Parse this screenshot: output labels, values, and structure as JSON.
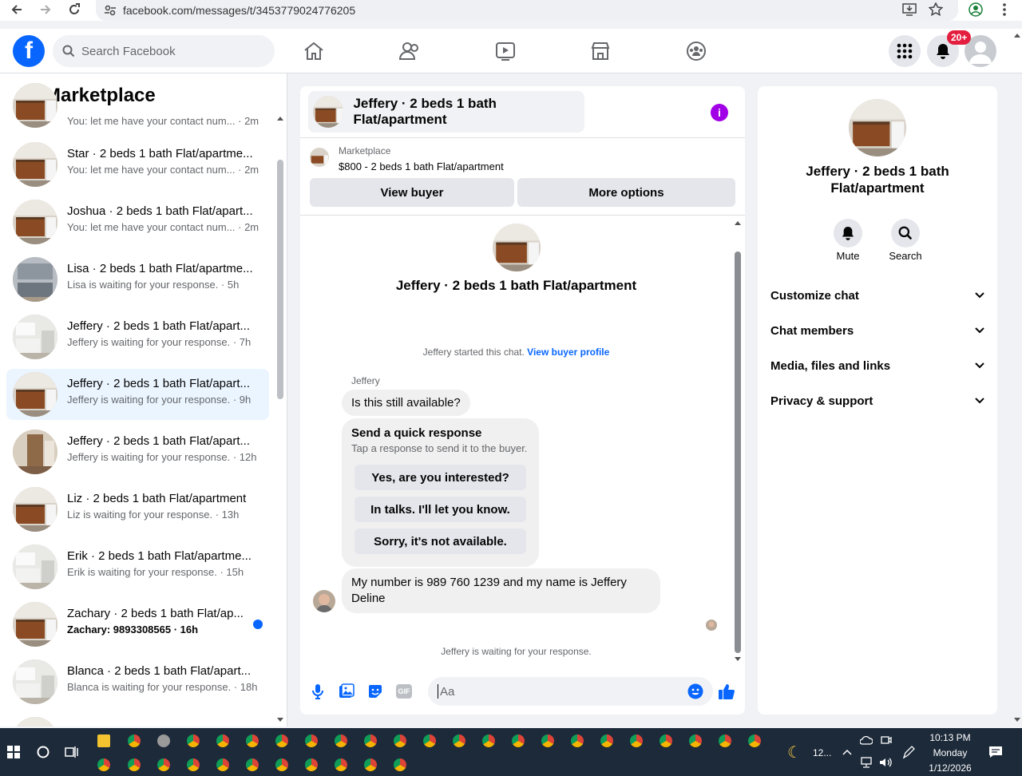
{
  "browser": {
    "url": "facebook.com/messages/t/3453779024776205"
  },
  "header": {
    "search_placeholder": "Search Facebook",
    "notif_badge": "20+",
    "logo_letter": "f"
  },
  "left": {
    "title": "Marketplace",
    "top_partial_sub": "You: let me have your contact num... · 2m",
    "conversations": [
      {
        "title": "Star · 2 beds 1 bath Flat/apartme...",
        "sub": "You: let me have your contact num... · 2m",
        "bold": false,
        "unread": false,
        "photo": "kitchen"
      },
      {
        "title": "Joshua · 2 beds 1 bath Flat/apart...",
        "sub": "You: let me have your contact num... · 2m",
        "bold": false,
        "unread": false,
        "photo": "kitchen"
      },
      {
        "title": "Lisa · 2 beds 1 bath Flat/apartme...",
        "sub": "Lisa is waiting for your response. · 5h",
        "bold": false,
        "unread": false,
        "photo": "grey"
      },
      {
        "title": "Jeffery · 2 beds 1 bath Flat/apart...",
        "sub": "Jeffery is waiting for your response. · 7h",
        "bold": false,
        "unread": false,
        "photo": "white"
      },
      {
        "title": "Jeffery · 2 beds 1 bath Flat/apart...",
        "sub": "Jeffery is waiting for your response. · 9h",
        "bold": false,
        "unread": false,
        "photo": "kitchen",
        "selected": true
      },
      {
        "title": "Jeffery · 2 beds 1 bath Flat/apart...",
        "sub": "Jeffery is waiting for your response. · 12h",
        "bold": false,
        "unread": false,
        "photo": "hall"
      },
      {
        "title": "Liz · 2 beds 1 bath Flat/apartment",
        "sub": "Liz is waiting for your response. · 13h",
        "bold": false,
        "unread": false,
        "photo": "kitchen"
      },
      {
        "title": "Erik · 2 beds 1 bath Flat/apartme...",
        "sub": "Erik is waiting for your response. · 15h",
        "bold": false,
        "unread": false,
        "photo": "white"
      },
      {
        "title": "Zachary · 2 beds 1 bath Flat/ap...",
        "sub": "Zachary: 9893308565 · 16h",
        "bold": true,
        "unread": true,
        "photo": "kitchen"
      },
      {
        "title": "Blanca · 2 beds 1 bath Flat/apart...",
        "sub": "Blanca is waiting for your response. · 18h",
        "bold": false,
        "unread": false,
        "photo": "white"
      }
    ]
  },
  "chat": {
    "header_title": "Jeffery · 2 beds 1 bath Flat/apartment",
    "info_icon": "i",
    "marketplace_label": "Marketplace",
    "listing": "$800 - 2 beds 1 bath Flat/apartment",
    "view_buyer": "View buyer",
    "more_options": "More options",
    "big_name": "Jeffery · 2 beds 1 bath Flat/apartment",
    "started_text": "Jeffery started this chat.",
    "view_profile": "View buyer profile",
    "sender": "Jeffery",
    "msg1": "Is this still available?",
    "quick_title": "Send a quick response",
    "quick_sub": "Tap a response to send it to the buyer.",
    "quick_options": [
      "Yes, are you interested?",
      "In talks. I'll let you know.",
      "Sorry, it's not available."
    ],
    "msg2": "My number is 989 760 1239 and my name is Jeffery Deline",
    "waiting": "Jeffery is waiting for your response.",
    "composer_placeholder": "Aa",
    "gif_label": "GIF"
  },
  "details": {
    "name": "Jeffery · 2 beds 1 bath Flat/apartment",
    "mute": "Mute",
    "search": "Search",
    "sections": [
      "Customize chat",
      "Chat members",
      "Media, files and links",
      "Privacy & support"
    ]
  },
  "taskbar": {
    "weather": "12...",
    "time": "10:13 PM",
    "day": "Monday",
    "date": "1/12/2026"
  }
}
